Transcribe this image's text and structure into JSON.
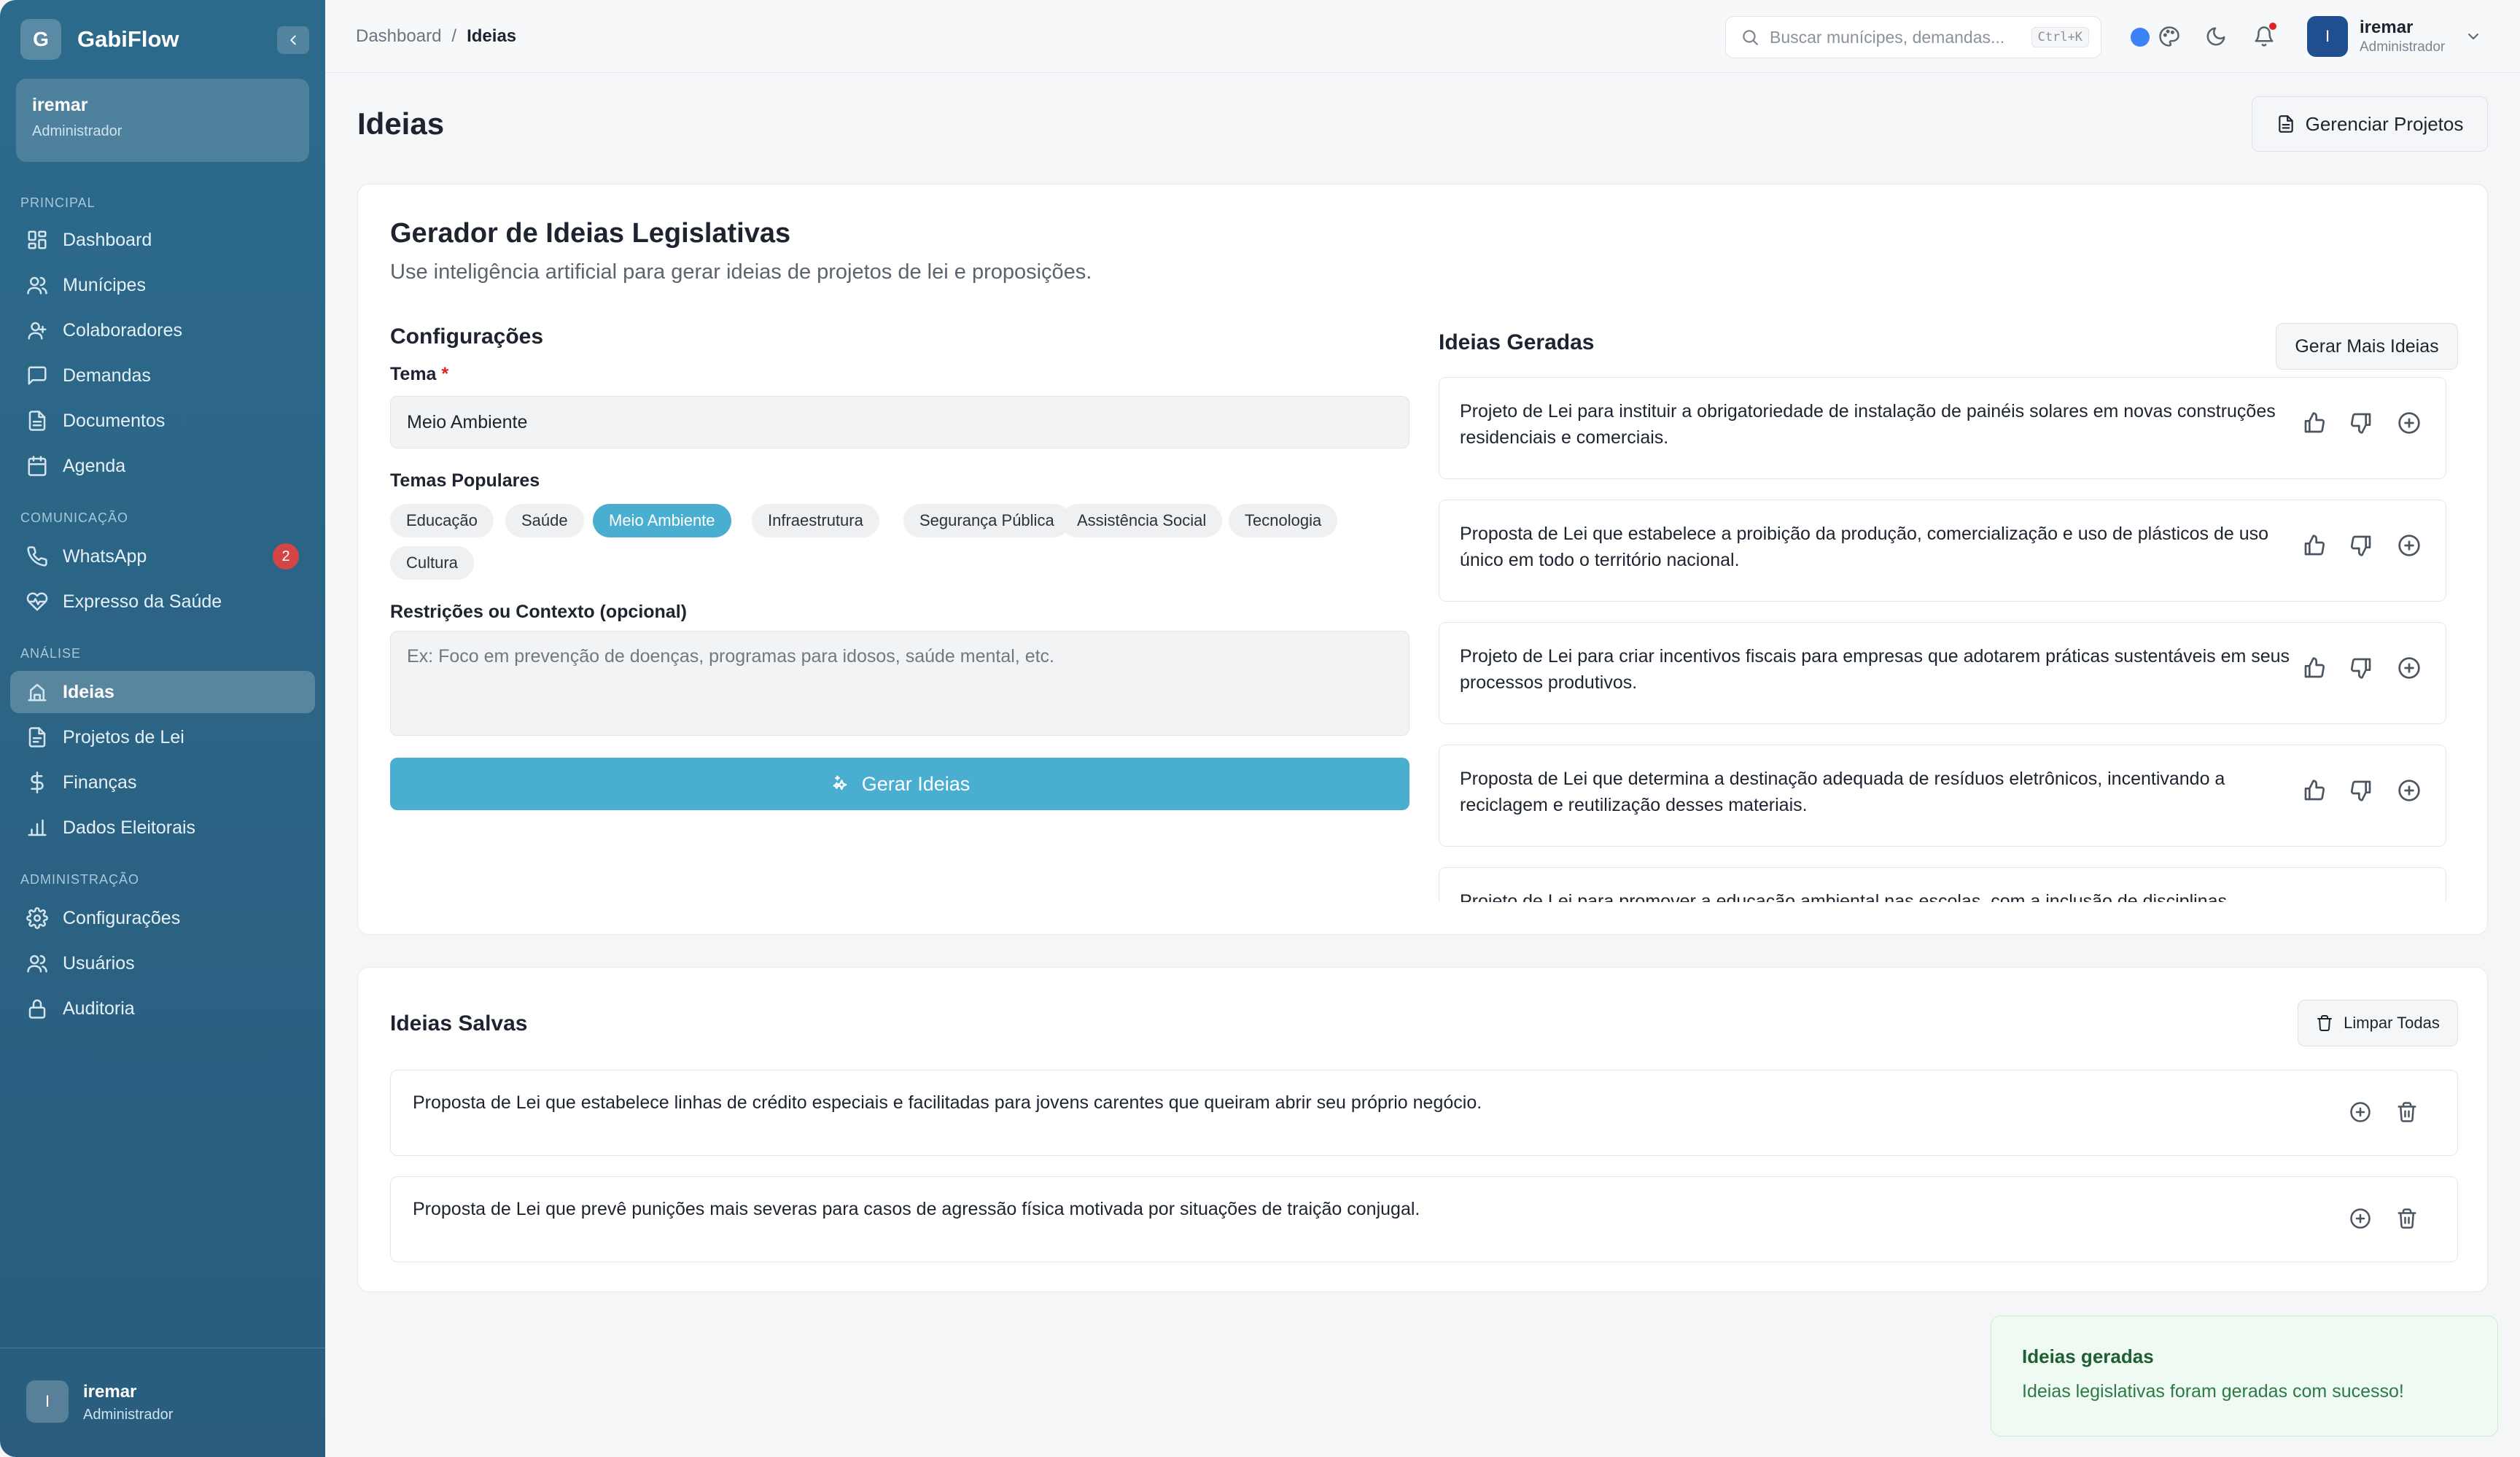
{
  "app": {
    "logo_letter": "G",
    "name": "GabiFlow"
  },
  "sidebar": {
    "user": {
      "name": "iremar",
      "role": "Administrador"
    },
    "sections": {
      "principal": "PRINCIPAL",
      "comunicacao": "COMUNICAÇÃO",
      "analise": "ANÁLISE",
      "administracao": "ADMINISTRAÇÃO"
    },
    "items": [
      {
        "label": "Dashboard",
        "icon": "grid-icon"
      },
      {
        "label": "Munícipes",
        "icon": "users-icon"
      },
      {
        "label": "Colaboradores",
        "icon": "user-icon"
      },
      {
        "label": "Demandas",
        "icon": "message-icon"
      },
      {
        "label": "Documentos",
        "icon": "file-icon"
      },
      {
        "label": "Agenda",
        "icon": "calendar-icon"
      },
      {
        "label": "WhatsApp",
        "icon": "phone-icon",
        "badge": "2"
      },
      {
        "label": "Expresso da Saúde",
        "icon": "heart-pulse-icon"
      },
      {
        "label": "Ideias",
        "icon": "lightbulb-icon",
        "active": true
      },
      {
        "label": "Projetos de Lei",
        "icon": "file-text-icon"
      },
      {
        "label": "Finanças",
        "icon": "dollar-icon"
      },
      {
        "label": "Dados Eleitorais",
        "icon": "bar-chart-icon"
      },
      {
        "label": "Configurações",
        "icon": "gear-icon"
      },
      {
        "label": "Usuários",
        "icon": "users-icon"
      },
      {
        "label": "Auditoria",
        "icon": "lock-icon"
      }
    ],
    "footer": {
      "avatar": "I",
      "name": "iremar",
      "role": "Administrador"
    }
  },
  "topbar": {
    "breadcrumb": {
      "parent": "Dashboard",
      "separator": "/",
      "current": "Ideias"
    },
    "search": {
      "placeholder": "Buscar munícipes, demandas...",
      "shortcut": "Ctrl+K"
    },
    "user": {
      "avatar": "I",
      "name": "iremar",
      "role": "Administrador"
    }
  },
  "page": {
    "title": "Ideias",
    "manage_button": "Gerenciar Projetos"
  },
  "generator": {
    "title": "Gerador de Ideias Legislativas",
    "subtitle": "Use inteligência artificial para gerar ideias de projetos de lei e proposições.",
    "config_title": "Configurações",
    "theme_label": "Tema",
    "theme_required": "*",
    "theme_value": "Meio Ambiente",
    "popular_label": "Temas Populares",
    "popular_themes": [
      "Educação",
      "Saúde",
      "Meio Ambiente",
      "Infraestrutura",
      "Segurança Pública",
      "Assistência Social",
      "Tecnologia",
      "Cultura"
    ],
    "selected_theme": "Meio Ambiente",
    "context_label": "Restrições ou Contexto (opcional)",
    "context_placeholder": "Ex: Foco em prevenção de doenças, programas para idosos, saúde mental, etc.",
    "generate_button": "Gerar Ideias"
  },
  "generated": {
    "title": "Ideias Geradas",
    "more_button": "Gerar Mais Ideias",
    "ideas": [
      "Projeto de Lei para instituir a obrigatoriedade de instalação de painéis solares em novas construções residenciais e comerciais.",
      "Proposta de Lei que estabelece a proibição da produção, comercialização e uso de plásticos de uso único em todo o território nacional.",
      "Projeto de Lei para criar incentivos fiscais para empresas que adotarem práticas sustentáveis em seus processos produtivos.",
      "Proposta de Lei que determina a destinação adequada de resíduos eletrônicos, incentivando a reciclagem e reutilização desses materiais.",
      "Projeto de Lei para promover a educação ambiental nas escolas, com a inclusão de disciplinas"
    ]
  },
  "saved": {
    "title": "Ideias Salvas",
    "clear_button": "Limpar Todas",
    "ideas": [
      "Proposta de Lei que estabelece linhas de crédito especiais e facilitadas para jovens carentes que queiram abrir seu próprio negócio.",
      "Proposta de Lei que prevê punições mais severas para casos de agressão física motivada por situações de traição conjugal."
    ]
  },
  "toast": {
    "title": "Ideias geradas",
    "message": "Ideias legislativas foram geradas com sucesso!"
  },
  "colors": {
    "sidebar": "#2c6a8c",
    "accent": "#4aaed0",
    "badge": "#d64545",
    "toast_bg": "#effaf2"
  }
}
